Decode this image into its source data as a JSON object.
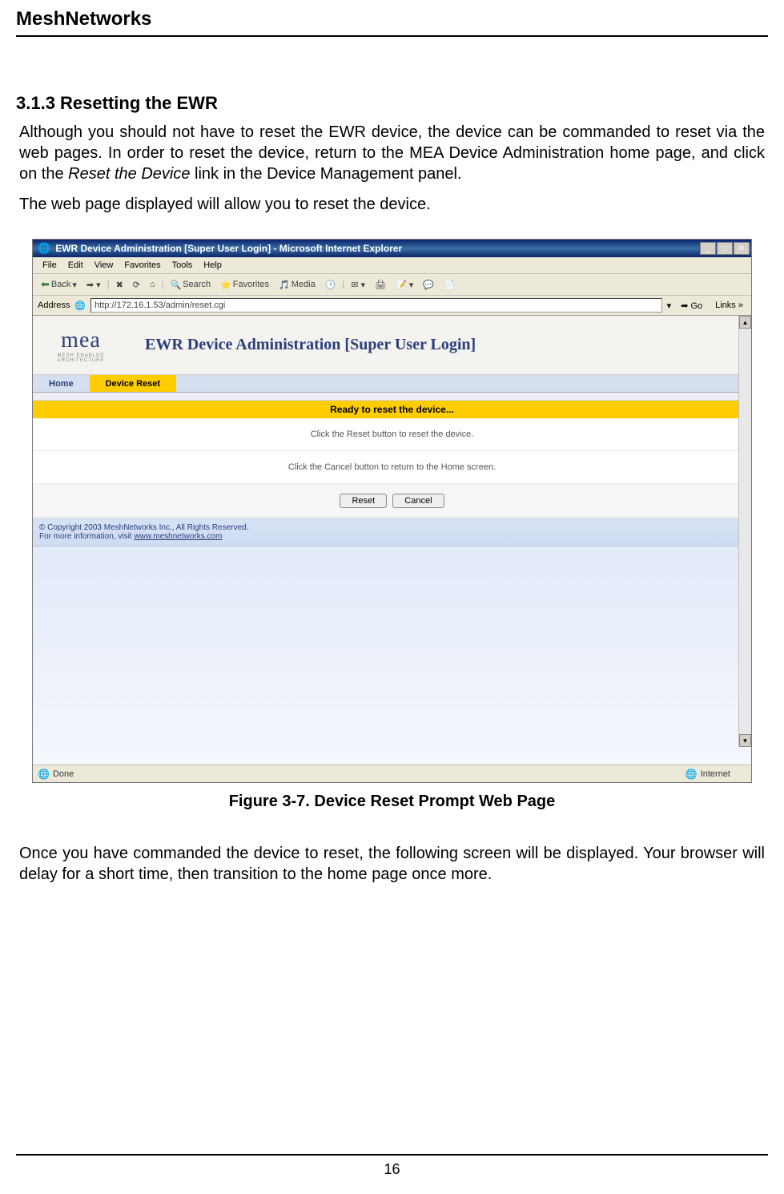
{
  "doc": {
    "header": "MeshNetworks",
    "section_heading": "3.1.3  Resetting the EWR",
    "para1_a": "Although you should not have to reset the EWR device, the device can be commanded to reset via the web pages. In order to reset the device, return to the MEA Device Administration home page, and click on the ",
    "para1_italic": "Reset the Device",
    "para1_b": " link in the Device Management panel.",
    "para2": "The web page displayed will allow you to reset the device.",
    "caption": "Figure 3-7.      Device Reset Prompt Web Page",
    "para3": "Once you have commanded the device to reset, the following screen will be displayed.  Your browser will delay for a short time, then transition to the home page once more.",
    "page_number": "16"
  },
  "browser": {
    "title": "EWR Device Administration [Super User Login] - Microsoft Internet Explorer",
    "menus": [
      "File",
      "Edit",
      "View",
      "Favorites",
      "Tools",
      "Help"
    ],
    "toolbar": {
      "back": "Back",
      "search": "Search",
      "favorites": "Favorites",
      "media": "Media"
    },
    "address_label": "Address",
    "address_value": "http://172.16.1.53/admin/reset.cgi",
    "go": "Go",
    "links": "Links",
    "status_done": "Done",
    "status_zone": "Internet"
  },
  "page": {
    "logo": "mea",
    "logo_sub": "MESH ENABLED ARCHITECTURE",
    "title": "EWR Device Administration [Super User Login]",
    "nav_home": "Home",
    "nav_reset": "Device Reset",
    "ready_band": "Ready to reset the device...",
    "instr1": "Click the Reset button to reset the device.",
    "instr2": "Click the Cancel button to return to the Home screen.",
    "btn_reset": "Reset",
    "btn_cancel": "Cancel",
    "copyright": "© Copyright 2003 MeshNetworks Inc., All Rights Reserved.",
    "more_info_a": "For more information, visit ",
    "more_info_link": "www.meshnetworks.com"
  }
}
